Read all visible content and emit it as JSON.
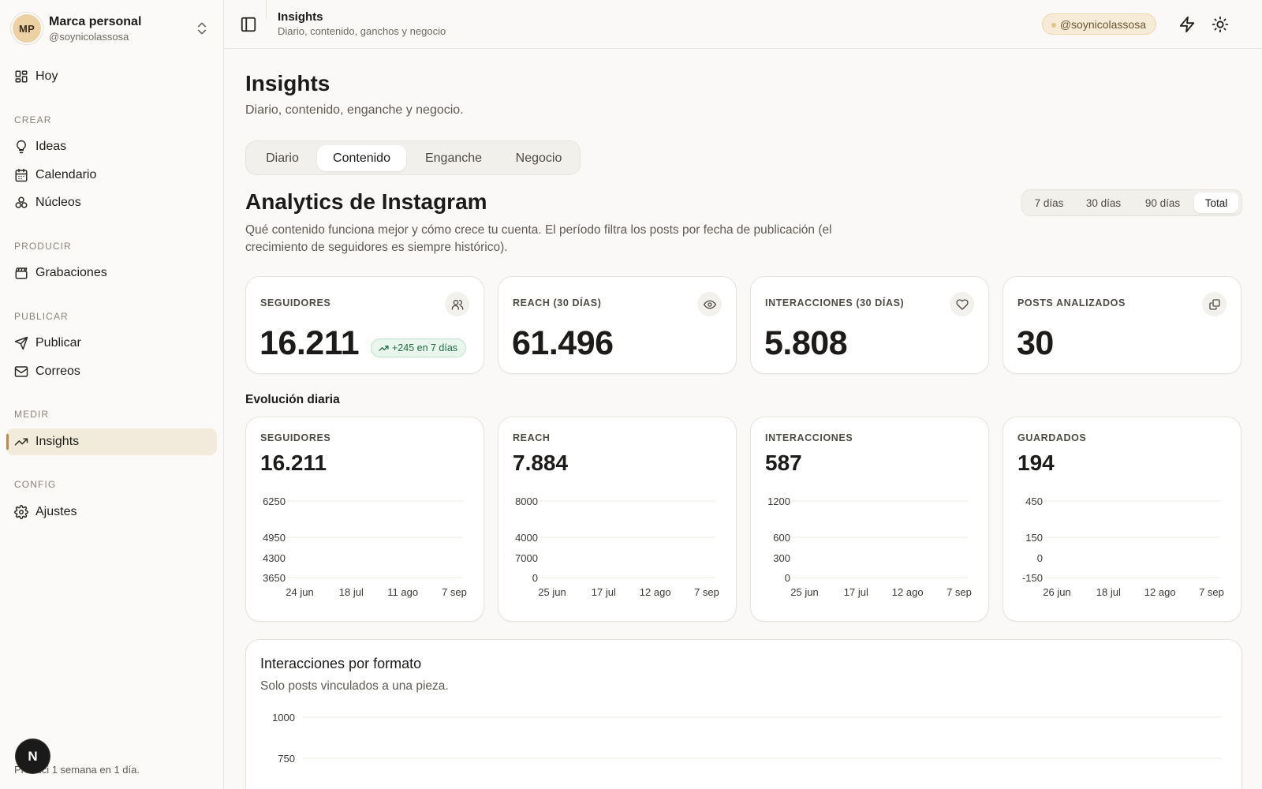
{
  "brand": {
    "initials": "MP",
    "name": "Marca personal",
    "handle": "@soynicolassosa"
  },
  "sidebar": {
    "top_item": {
      "label": "Hoy",
      "icon": "dashboard-icon"
    },
    "sections": [
      {
        "label": "CREAR",
        "items": [
          {
            "label": "Ideas",
            "icon": "lightbulb-icon"
          },
          {
            "label": "Calendario",
            "icon": "calendar-icon"
          },
          {
            "label": "Núcleos",
            "icon": "nodes-icon"
          }
        ]
      },
      {
        "label": "PRODUCIR",
        "items": [
          {
            "label": "Grabaciones",
            "icon": "clapperboard-icon"
          }
        ]
      },
      {
        "label": "PUBLICAR",
        "items": [
          {
            "label": "Publicar",
            "icon": "send-icon"
          },
          {
            "label": "Correos",
            "icon": "mail-icon"
          }
        ]
      },
      {
        "label": "MEDIR",
        "items": [
          {
            "label": "Insights",
            "icon": "trending-up-icon",
            "active": true
          }
        ]
      },
      {
        "label": "CONFIG",
        "items": [
          {
            "label": "Ajustes",
            "icon": "gear-icon"
          }
        ]
      }
    ],
    "footer_note": "Produci 1 semana en 1 día.",
    "n_badge": "N"
  },
  "topbar": {
    "title": "Insights",
    "subtitle": "Diario, contenido, ganchos y negocio",
    "handle_pill": "@soynicolassosa"
  },
  "page": {
    "title": "Insights",
    "subtitle": "Diario, contenido, enganche y negocio.",
    "tabs": [
      "Diario",
      "Contenido",
      "Enganche",
      "Negocio"
    ],
    "active_tab": "Contenido"
  },
  "analytics": {
    "title": "Analytics de Instagram",
    "description": "Qué contenido funciona mejor y cómo crece tu cuenta. El período filtra los posts por fecha de publicación (el crecimiento de seguidores es siempre histórico).",
    "periods": [
      "7 días",
      "30 días",
      "90 días",
      "Total"
    ],
    "active_period": "Total"
  },
  "kpis": [
    {
      "label": "SEGUIDORES",
      "value": "16.211",
      "icon": "users-icon",
      "badge": "+245 en 7 días"
    },
    {
      "label": "REACH (30 DÍAS)",
      "value": "61.496",
      "icon": "eye-icon"
    },
    {
      "label": "INTERACCIONES (30 DÍAS)",
      "value": "5.808",
      "icon": "heart-icon"
    },
    {
      "label": "POSTS ANALIZADOS",
      "value": "30",
      "icon": "copy-icon"
    }
  ],
  "evolution": {
    "title": "Evolución diaria",
    "cards": [
      {
        "label": "SEGUIDORES",
        "value": "16.211"
      },
      {
        "label": "REACH",
        "value": "7.884"
      },
      {
        "label": "INTERACCIONES",
        "value": "587"
      },
      {
        "label": "GUARDADOS",
        "value": "194"
      }
    ]
  },
  "chart_data": [
    {
      "type": "line",
      "title": "SEGUIDORES",
      "yticks": [
        "6250",
        "4950",
        "4300",
        "3650"
      ],
      "xticks": [
        "24 jun",
        "18 jul",
        "11 ago",
        "7 sep"
      ],
      "series": []
    },
    {
      "type": "line",
      "title": "REACH",
      "yticks": [
        "8000",
        "4000",
        "7000",
        "0"
      ],
      "xticks": [
        "25 jun",
        "17 jul",
        "12 ago",
        "7 sep"
      ],
      "series": []
    },
    {
      "type": "line",
      "title": "INTERACCIONES",
      "yticks": [
        "1200",
        "600",
        "300",
        "0"
      ],
      "xticks": [
        "25 jun",
        "17 jul",
        "12 ago",
        "7 sep"
      ],
      "series": []
    },
    {
      "type": "line",
      "title": "GUARDADOS",
      "yticks": [
        "450",
        "150",
        "0",
        "-150"
      ],
      "xticks": [
        "26 jun",
        "18 jul",
        "12 ago",
        "7 sep"
      ],
      "series": []
    },
    {
      "type": "bar",
      "title": "Interacciones por formato",
      "subtitle": "Solo posts vinculados a una pieza.",
      "yticks": [
        "1000",
        "750"
      ],
      "series": []
    }
  ],
  "colors": {
    "accent": "#b88b4a",
    "active_bg": "#f2eadb",
    "positive": "#1f6b40"
  }
}
